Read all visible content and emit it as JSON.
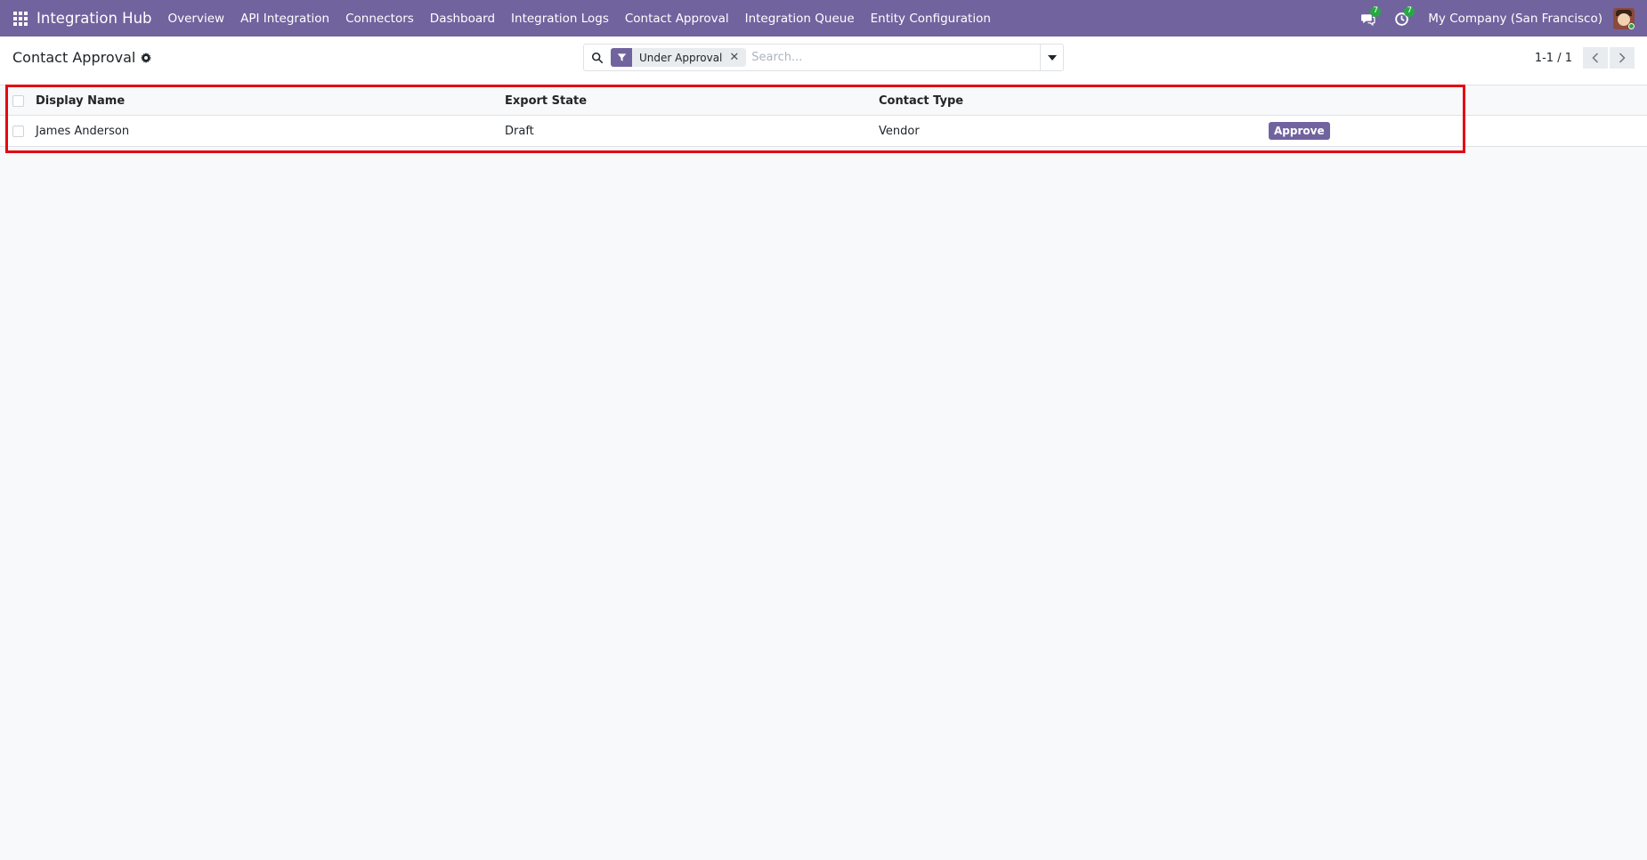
{
  "navbar": {
    "brand": "Integration Hub",
    "menu": [
      "Overview",
      "API Integration",
      "Connectors",
      "Dashboard",
      "Integration Logs",
      "Contact Approval",
      "Integration Queue",
      "Entity Configuration"
    ],
    "messages_badge": "7",
    "activities_badge": "7",
    "company": "My Company (San Francisco)"
  },
  "control_panel": {
    "title": "Contact Approval",
    "search": {
      "facet_label": "Under Approval",
      "placeholder": "Search..."
    },
    "pager": "1-1 / 1"
  },
  "list": {
    "columns": [
      "Display Name",
      "Export State",
      "Contact Type"
    ],
    "rows": [
      {
        "display_name": "James Anderson",
        "export_state": "Draft",
        "contact_type": "Vendor",
        "action": "Approve"
      }
    ]
  },
  "colors": {
    "brand": "#71639e",
    "highlight": "#e30613",
    "badge": "#28a745"
  }
}
